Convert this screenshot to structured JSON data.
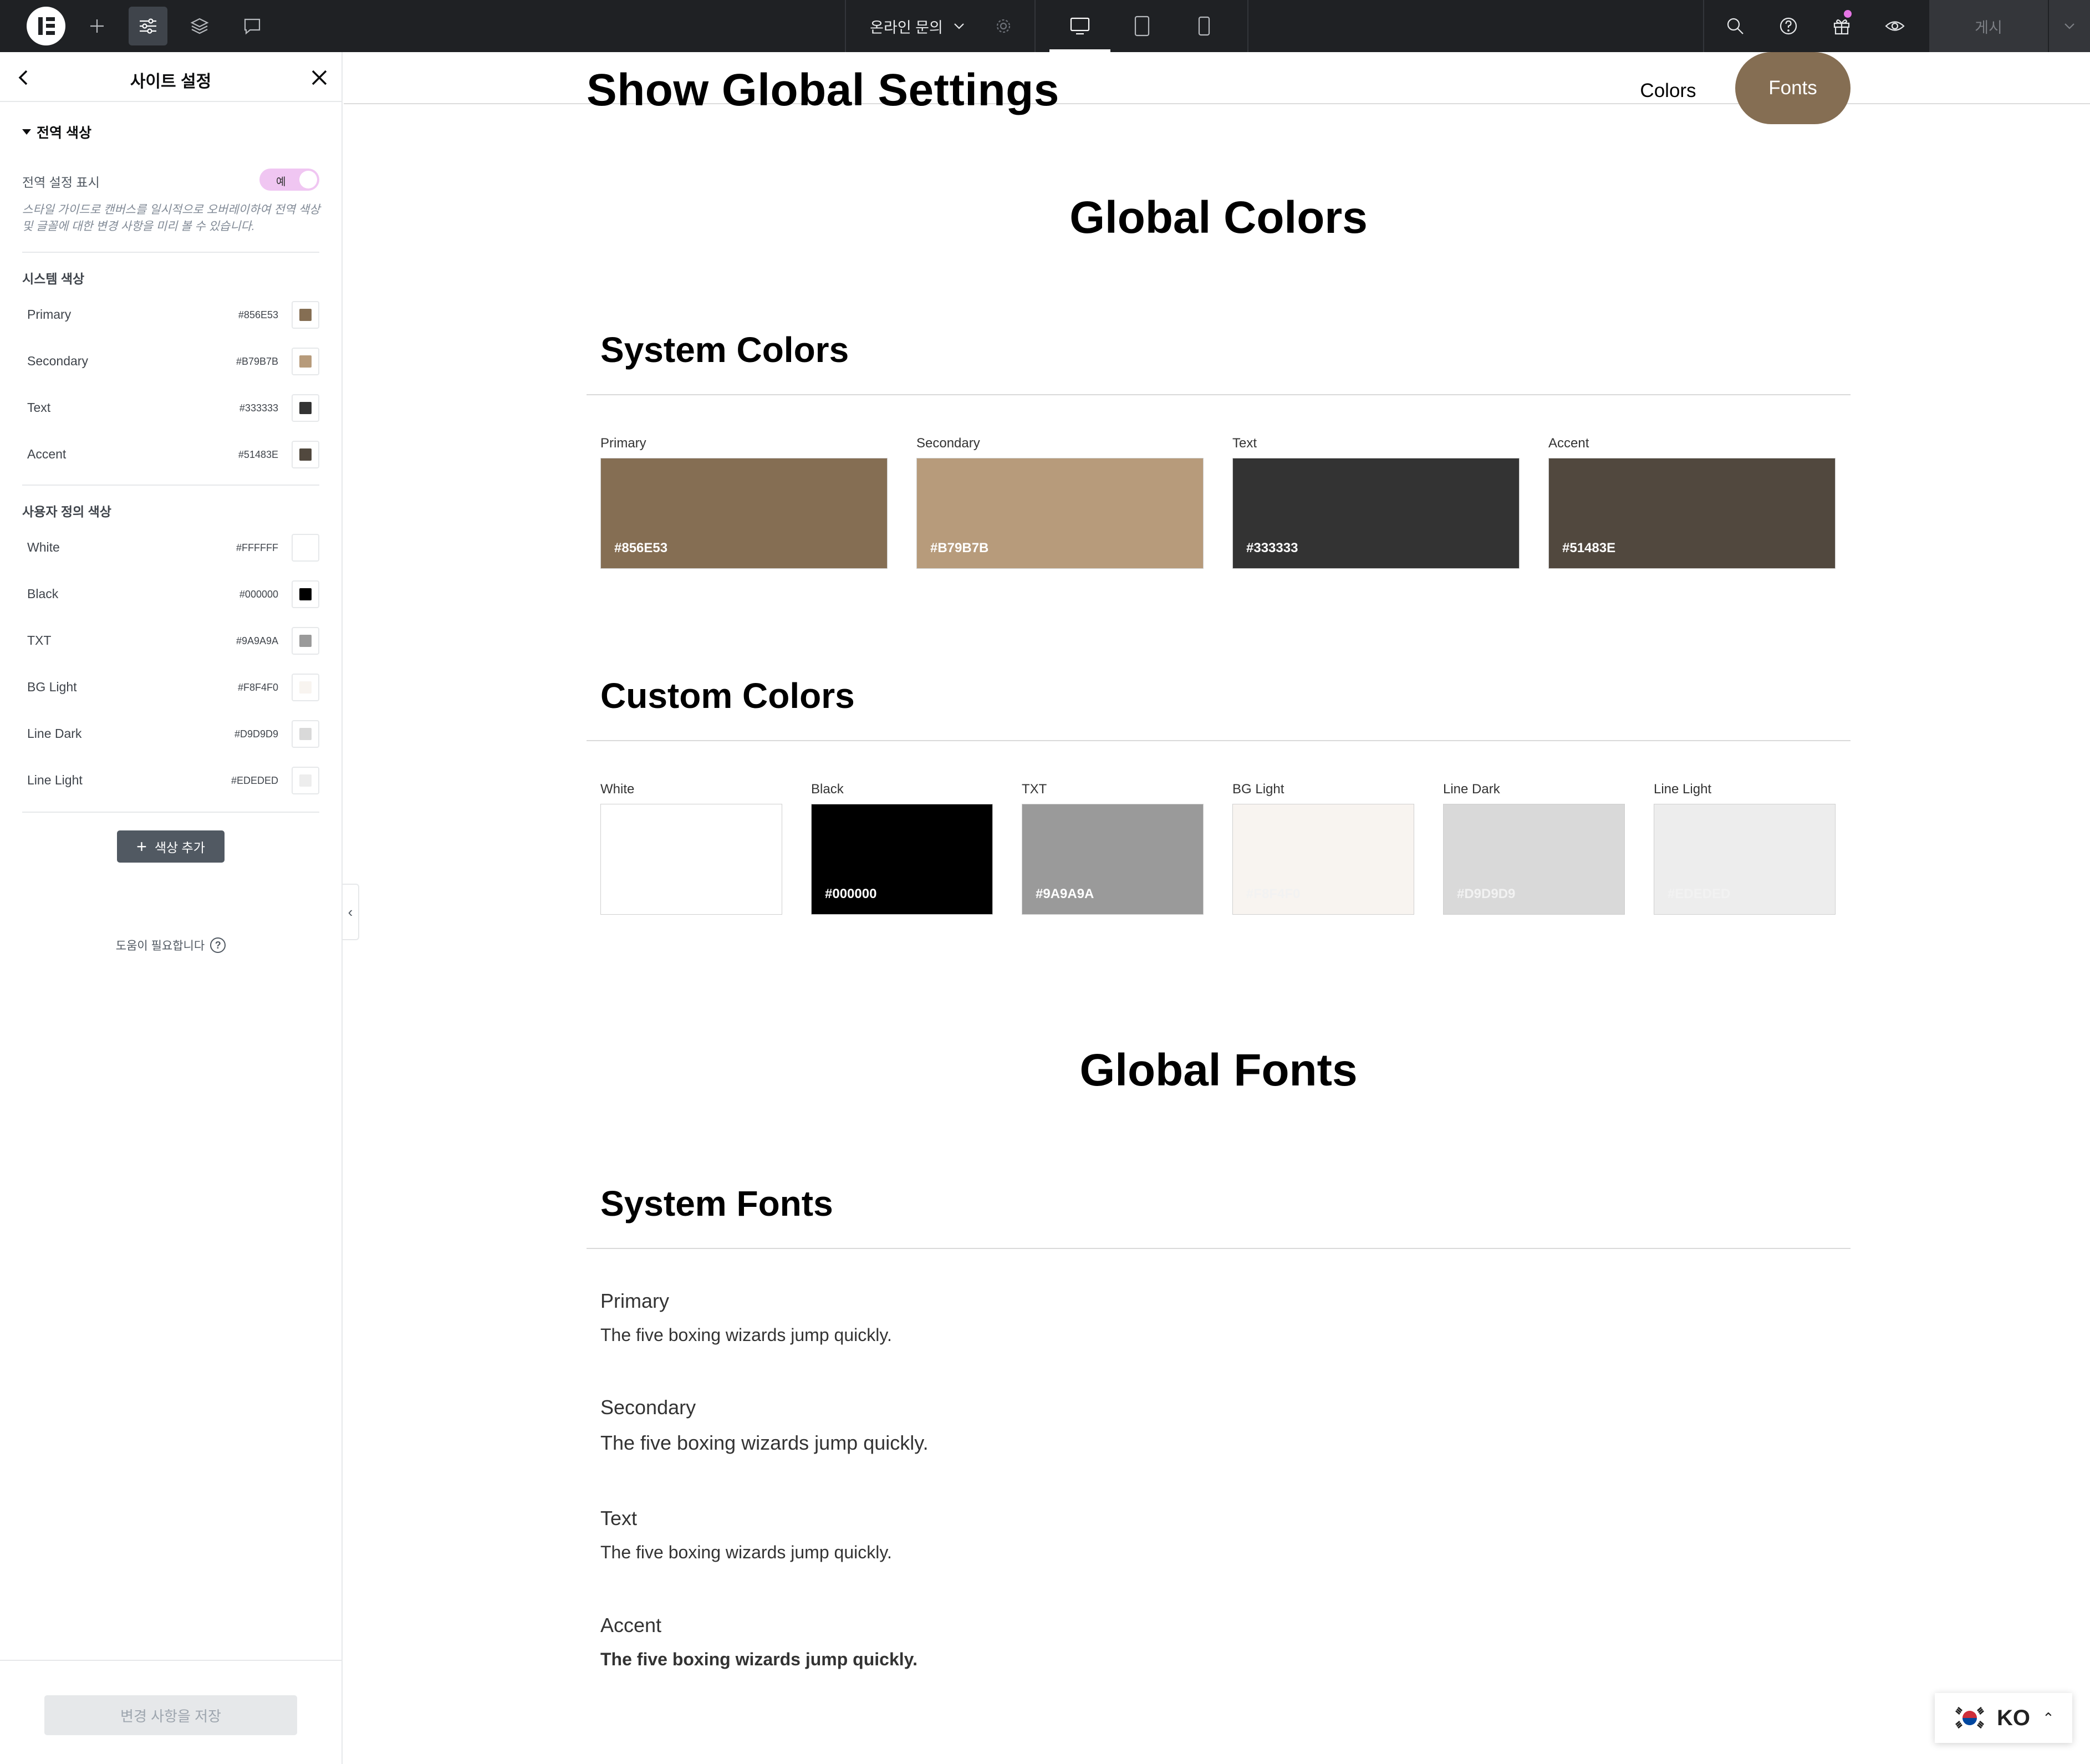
{
  "topbar": {
    "page_name": "온라인 문의",
    "publish_label": "게시"
  },
  "panel": {
    "title": "사이트 설정",
    "global_section_title": "전역 색상",
    "show_global_label": "전역 설정 표시",
    "toggle_label": "예",
    "show_global_desc": "스타일 가이드로 캔버스를 일시적으로 오버레이하여 전역 색상 및 글꼴에 대한 변경 사항을 미리 볼 수 있습니다.",
    "system_colors_title": "시스템 색상",
    "system_colors": [
      {
        "name": "Primary",
        "hex": "#856E53"
      },
      {
        "name": "Secondary",
        "hex": "#B79B7B"
      },
      {
        "name": "Text",
        "hex": "#333333"
      },
      {
        "name": "Accent",
        "hex": "#51483E"
      }
    ],
    "custom_colors_title": "사용자 정의 색상",
    "custom_colors": [
      {
        "name": "White",
        "hex": "#FFFFFF"
      },
      {
        "name": "Black",
        "hex": "#000000"
      },
      {
        "name": "TXT",
        "hex": "#9A9A9A"
      },
      {
        "name": "BG Light",
        "hex": "#F8F4F0"
      },
      {
        "name": "Line Dark",
        "hex": "#D9D9D9"
      },
      {
        "name": "Line Light",
        "hex": "#EDEDED"
      }
    ],
    "add_color_label": "색상 추가",
    "need_help": "도움이 필요합니다",
    "save_label": "변경 사항을 저장"
  },
  "canvas": {
    "page_heading": "Show Global Settings",
    "nav": {
      "colors": "Colors",
      "fonts": "Fonts"
    },
    "global_colors_title": "Global Colors",
    "system_colors_title": "System Colors",
    "system_swatches": [
      {
        "label": "Primary",
        "hex": "#856E53"
      },
      {
        "label": "Secondary",
        "hex": "#B79B7B"
      },
      {
        "label": "Text",
        "hex": "#333333"
      },
      {
        "label": "Accent",
        "hex": "#51483E"
      }
    ],
    "custom_colors_title": "Custom Colors",
    "custom_swatches": [
      {
        "label": "White",
        "hex": "#FFFFFF"
      },
      {
        "label": "Black",
        "hex": "#000000"
      },
      {
        "label": "TXT",
        "hex": "#9A9A9A"
      },
      {
        "label": "BG Light",
        "hex": "#F8F4F0"
      },
      {
        "label": "Line Dark",
        "hex": "#D9D9D9"
      },
      {
        "label": "Line Light",
        "hex": "#EDEDED"
      }
    ],
    "global_fonts_title": "Global Fonts",
    "system_fonts_title": "System Fonts",
    "fonts": [
      {
        "name": "Primary",
        "sample": "The five boxing wizards jump quickly."
      },
      {
        "name": "Secondary",
        "sample": "The five boxing wizards jump quickly."
      },
      {
        "name": "Text",
        "sample": "The five boxing wizards jump quickly."
      },
      {
        "name": "Accent",
        "sample": "The five boxing wizards jump quickly."
      }
    ]
  },
  "language": {
    "code": "KO"
  },
  "colors": {
    "topbar_bg": "#1F2124",
    "accent_pink": "#F0C6F2",
    "brand_brown": "#856E53"
  }
}
